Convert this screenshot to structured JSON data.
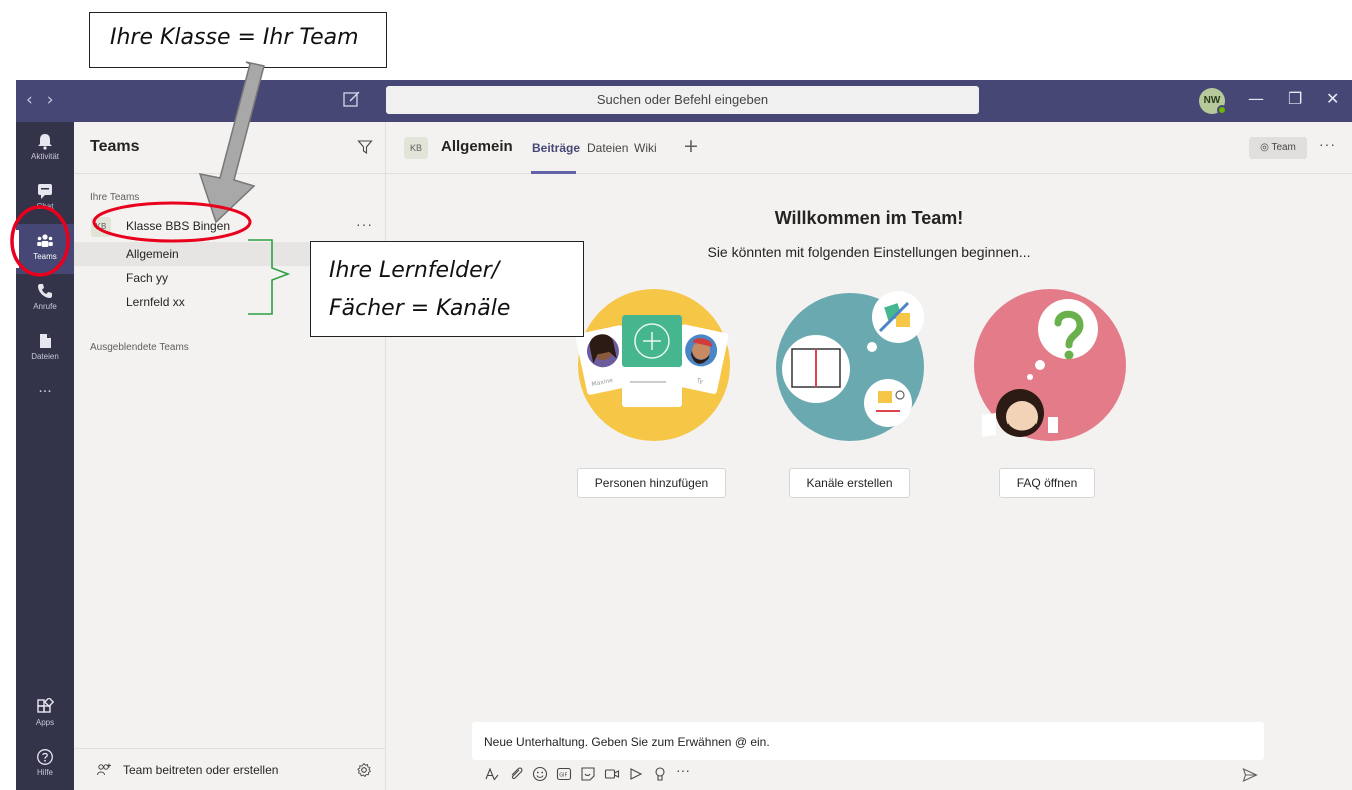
{
  "annotations": {
    "klasse_team": "Ihre Klasse = Ihr Team",
    "lernfelder_line1": "Ihre Lernfelder/",
    "lernfelder_line2": "Fächer = Kanäle"
  },
  "titlebar": {
    "search_placeholder": "Suchen oder Befehl eingeben",
    "user_initials": "NW"
  },
  "appbar": {
    "items": [
      {
        "label": "Aktivität",
        "icon": "bell-icon"
      },
      {
        "label": "Chat",
        "icon": "chat-icon"
      },
      {
        "label": "Teams",
        "icon": "teams-icon"
      },
      {
        "label": "Anrufe",
        "icon": "phone-icon"
      },
      {
        "label": "Dateien",
        "icon": "file-icon"
      },
      {
        "label": "Apps",
        "icon": "apps-icon"
      },
      {
        "label": "Hilfe",
        "icon": "help-icon"
      }
    ],
    "more": "..."
  },
  "teams_panel": {
    "title": "Teams",
    "section_your_teams": "Ihre Teams",
    "team": {
      "badge": "KB",
      "name": "Klasse BBS Bingen"
    },
    "channels": [
      "Allgemein",
      "Fach yy",
      "Lernfeld xx"
    ],
    "section_hidden": "Ausgeblendete Teams",
    "join_label": "Team beitreten oder erstellen"
  },
  "channel_header": {
    "badge": "KB",
    "title": "Allgemein",
    "tabs": [
      "Beiträge",
      "Dateien",
      "Wiki"
    ],
    "team_pill": "Team"
  },
  "main": {
    "welcome_title": "Willkommen im Team!",
    "welcome_sub": "Sie könnten mit folgenden Einstellungen beginnen...",
    "buttons": [
      "Personen hinzufügen",
      "Kanäle erstellen",
      "FAQ öffnen"
    ],
    "card_names": [
      "Maxine",
      "Ty"
    ]
  },
  "compose": {
    "placeholder": "Neue Unterhaltung. Geben Sie zum Erwähnen @ ein."
  },
  "colors": {
    "titlebar": "#464775",
    "appbar": "#33344a",
    "accent": "#6264a7",
    "annotation_red": "#e8001c",
    "annotation_green": "#2ea043"
  }
}
